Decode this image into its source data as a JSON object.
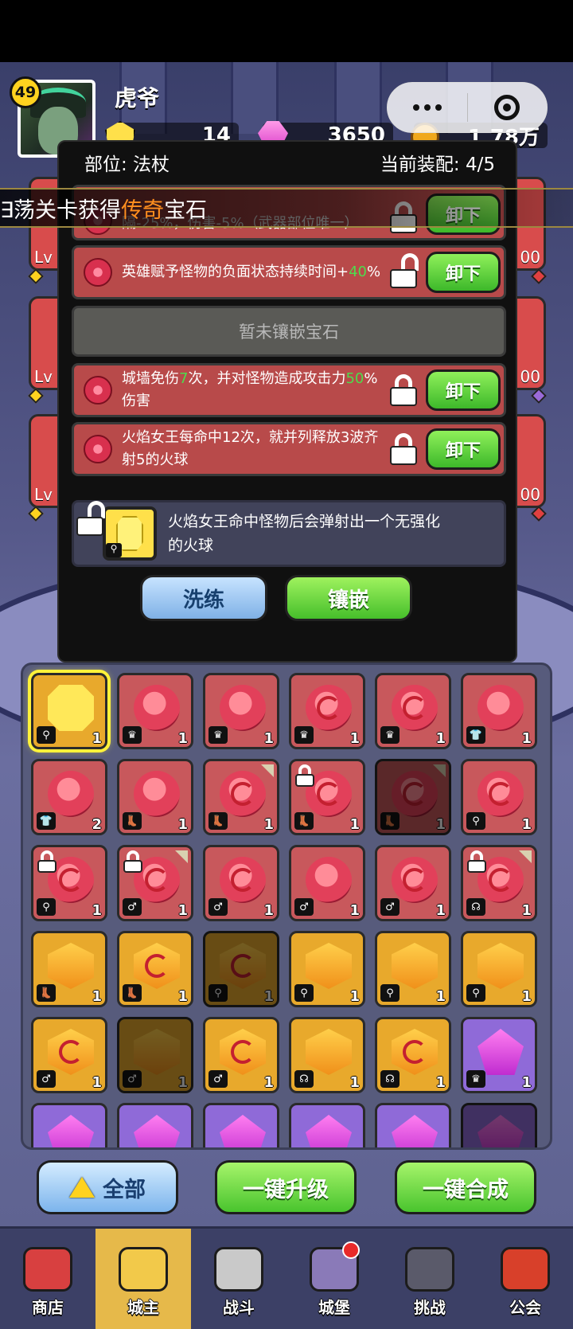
{
  "player": {
    "level": "49",
    "name": "虎爷"
  },
  "currencies": [
    {
      "icon": "yellow-gem-icon",
      "value": "14"
    },
    {
      "icon": "pink-gem-icon",
      "value": "3650"
    },
    {
      "icon": "gold-coin-icon",
      "value": "1.78万"
    }
  ],
  "side_slots": {
    "left_labels": [
      "Lv",
      "Lv",
      "Lv"
    ],
    "right_labels": [
      "00",
      "00",
      "00"
    ]
  },
  "banner": {
    "prefix": "∃荡关卡获得",
    "highlight": "传奇",
    "suffix": "宝石"
  },
  "panel": {
    "part_label": "部位: 法杖",
    "equip_label": "当前装配: 4/5",
    "unload_label": "卸下",
    "empty_label": "暂未镶嵌宝石",
    "gems": [
      {
        "text": "隔-25%，伤害-5%（武器部位唯一）",
        "text_top": "...火焰女王，攻击间",
        "locked": true
      },
      {
        "text_a": "英雄赋予怪物的负面状态持续时间+",
        "text_green": "40",
        "text_b": "%",
        "locked": false
      },
      {
        "text_a": "城墙免伤",
        "text_green": "7",
        "text_b": "次，并对怪物造成攻击力",
        "text_green2": "50",
        "text_c": "%伤害",
        "locked": true
      },
      {
        "text": "火焰女王每命中12次，就并列释放3波齐射5的火球",
        "locked": true
      }
    ],
    "skill_text": "火焰女王命中怪物后会弹射出一个无强化的火球",
    "refine_label": "洗练",
    "inlay_label": "镶嵌"
  },
  "inventory": [
    {
      "c": "gold",
      "g": "y",
      "t": "⚲",
      "n": "1",
      "sel": true
    },
    {
      "c": "red",
      "g": "r",
      "t": "♛",
      "n": "1"
    },
    {
      "c": "red",
      "g": "r",
      "t": "♛",
      "n": "1"
    },
    {
      "c": "red",
      "g": "r",
      "t": "♛",
      "n": "1",
      "sw": true
    },
    {
      "c": "red",
      "g": "r",
      "t": "♛",
      "n": "1",
      "sw": true
    },
    {
      "c": "red",
      "g": "r",
      "t": "👕",
      "n": "1"
    },
    {
      "c": "red",
      "g": "r",
      "t": "👕",
      "n": "2"
    },
    {
      "c": "red",
      "g": "r",
      "t": "👢",
      "n": "1"
    },
    {
      "c": "red",
      "g": "r",
      "t": "👢",
      "n": "1",
      "sw": true,
      "corner": true
    },
    {
      "c": "red",
      "g": "r",
      "t": "👢",
      "n": "1",
      "sw": true,
      "lock": true
    },
    {
      "c": "red",
      "g": "r",
      "t": "👢",
      "n": "1",
      "sw": true,
      "corner": true,
      "dim": true
    },
    {
      "c": "red",
      "g": "r",
      "t": "⚲",
      "n": "1",
      "sw": true
    },
    {
      "c": "red",
      "g": "r",
      "t": "⚲",
      "n": "1",
      "sw": true,
      "lock": true
    },
    {
      "c": "red",
      "g": "r",
      "t": "♂",
      "n": "1",
      "sw": true,
      "lock": true,
      "corner": true
    },
    {
      "c": "red",
      "g": "r",
      "t": "♂",
      "n": "1",
      "sw": true
    },
    {
      "c": "red",
      "g": "r",
      "t": "♂",
      "n": "1"
    },
    {
      "c": "red",
      "g": "r",
      "t": "♂",
      "n": "1",
      "sw": true
    },
    {
      "c": "red",
      "g": "r",
      "t": "☊",
      "n": "1",
      "sw": true,
      "lock": true,
      "corner": true
    },
    {
      "c": "gold",
      "g": "o",
      "t": "👢",
      "n": "1"
    },
    {
      "c": "gold",
      "g": "o",
      "t": "👢",
      "n": "1",
      "sw": true
    },
    {
      "c": "gold",
      "g": "o",
      "t": "⚲",
      "n": "1",
      "sw": true,
      "dim": true
    },
    {
      "c": "gold",
      "g": "o",
      "t": "⚲",
      "n": "1"
    },
    {
      "c": "gold",
      "g": "o",
      "t": "⚲",
      "n": "1"
    },
    {
      "c": "gold",
      "g": "o",
      "t": "⚲",
      "n": "1"
    },
    {
      "c": "gold",
      "g": "o",
      "t": "♂",
      "n": "1",
      "sw": true
    },
    {
      "c": "gold",
      "g": "o",
      "t": "♂",
      "n": "1",
      "dim": true
    },
    {
      "c": "gold",
      "g": "o",
      "t": "♂",
      "n": "1",
      "sw": true
    },
    {
      "c": "gold",
      "g": "o",
      "t": "☊",
      "n": "1"
    },
    {
      "c": "gold",
      "g": "o",
      "t": "☊",
      "n": "1",
      "sw": true
    },
    {
      "c": "purple",
      "g": "p",
      "t": "♛",
      "n": "1"
    },
    {
      "c": "purple",
      "g": "p",
      "t": "",
      "n": ""
    },
    {
      "c": "purple",
      "g": "p",
      "t": "",
      "n": ""
    },
    {
      "c": "purple",
      "g": "p",
      "t": "",
      "n": ""
    },
    {
      "c": "purple",
      "g": "p",
      "t": "",
      "n": ""
    },
    {
      "c": "purple",
      "g": "p",
      "t": "",
      "n": ""
    },
    {
      "c": "purple",
      "g": "p",
      "t": "",
      "n": "",
      "dim": true
    }
  ],
  "actions": {
    "all": "全部",
    "upgrade": "一键升级",
    "merge": "一键合成"
  },
  "nav": [
    {
      "label": "商店",
      "icon": "shop-icon",
      "color": "#d84040"
    },
    {
      "label": "城主",
      "icon": "crown-icon",
      "color": "#f2c94a",
      "active": true
    },
    {
      "label": "战斗",
      "icon": "swords-icon",
      "color": "#c9c9c9"
    },
    {
      "label": "城堡",
      "icon": "castle-icon",
      "color": "#8a7ab8",
      "badge": true
    },
    {
      "label": "挑战",
      "icon": "monster-icon",
      "color": "#5a5a6a"
    },
    {
      "label": "公会",
      "icon": "guild-flag-icon",
      "color": "#d8402a"
    }
  ],
  "colors": {
    "accent_green": "#4ddc4d",
    "legend_orange": "#ff8f1f",
    "panel_bg": "#101010"
  }
}
